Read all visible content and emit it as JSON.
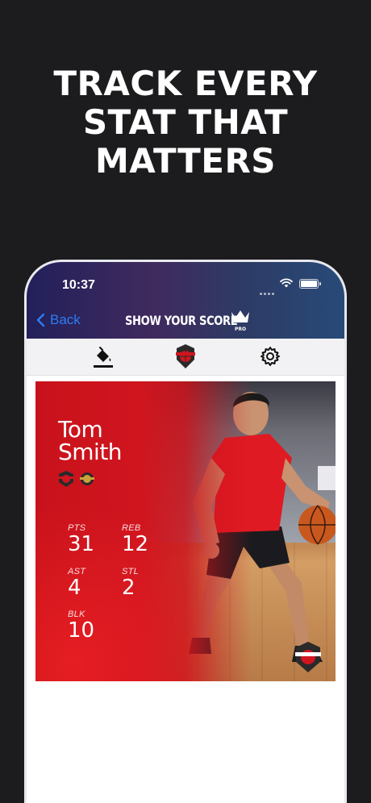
{
  "headline": {
    "line1": "TRACK EVERY",
    "line2": "STAT THAT",
    "line3": "MATTERS"
  },
  "status_bar": {
    "time": "10:37"
  },
  "nav": {
    "back_label": "Back",
    "title": "SHOW YOUR SCORE",
    "badge": "PRO"
  },
  "toolbar": {
    "items": [
      "paint-bucket-icon",
      "basketball-logo-icon",
      "gear-icon"
    ]
  },
  "card": {
    "first_name": "Tom",
    "last_name": "Smith",
    "stats": {
      "pts": {
        "label": "PTS",
        "value": "31"
      },
      "reb": {
        "label": "REB",
        "value": "12"
      },
      "ast": {
        "label": "AST",
        "value": "4"
      },
      "stl": {
        "label": "STL",
        "value": "2"
      },
      "blk": {
        "label": "BLK",
        "value": "10"
      }
    }
  },
  "colors": {
    "background": "#1c1c1e",
    "accent_red": "#d0151f",
    "link_blue": "#2d7cf6"
  }
}
